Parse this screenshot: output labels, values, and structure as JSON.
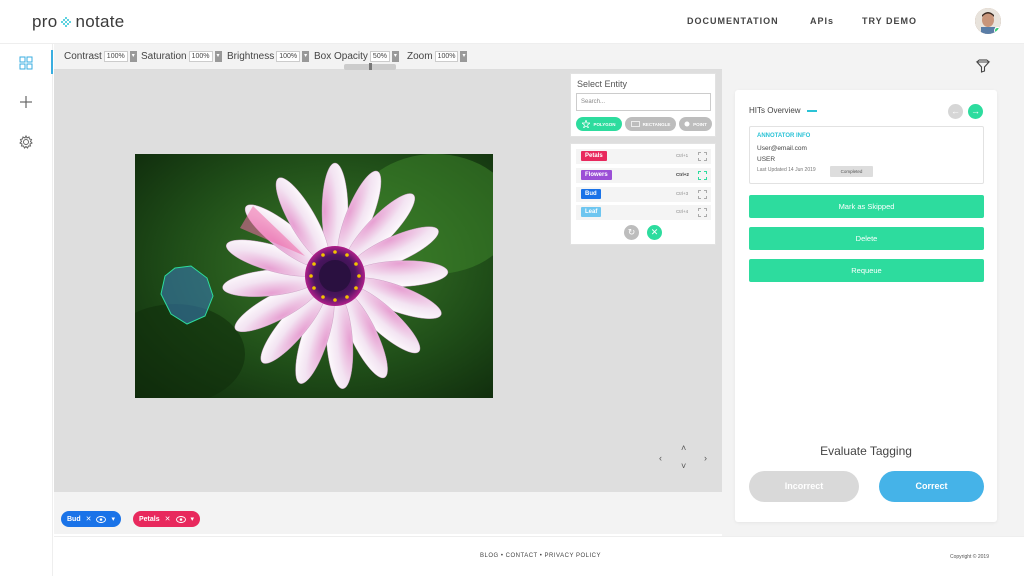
{
  "brand": {
    "logo_left": "pro",
    "logo_right": "notate"
  },
  "nav": {
    "documentation": "DOCUMENTATION",
    "apis": "APIs",
    "try_demo": "TRY DEMO"
  },
  "toolbar": {
    "contrast": {
      "label": "Contrast",
      "value": "100%"
    },
    "saturation": {
      "label": "Saturation",
      "value": "100%"
    },
    "brightness": {
      "label": "Brightness",
      "value": "100%"
    },
    "box_opacity": {
      "label": "Box Opacity",
      "value": "50%"
    },
    "zoom": {
      "label": "Zoom",
      "value": "100%"
    }
  },
  "entity_panel": {
    "title": "Select Entity",
    "search_placeholder": "Search...",
    "shapes": {
      "polygon": "POLYGON",
      "rectangle": "RECTANGLE",
      "point": "POINT"
    }
  },
  "labels": [
    {
      "name": "Petals",
      "shortcut": "Ctrl+1",
      "color": "#e8295d"
    },
    {
      "name": "Flowers",
      "shortcut": "Ctrl+2",
      "color": "#9b4fd6"
    },
    {
      "name": "Bud",
      "shortcut": "Ctrl+3",
      "color": "#1a73e8"
    },
    {
      "name": "Leaf",
      "shortcut": "Ctrl+4",
      "color": "#6ec6f0"
    }
  ],
  "tags": [
    {
      "name": "Bud",
      "color": "#1a73e8"
    },
    {
      "name": "Petals",
      "color": "#e8295d"
    }
  ],
  "right_panel": {
    "hits_title": "HITs Overview",
    "annotator_header": "ANNOTATOR INFO",
    "email": "User@email.com",
    "role": "USER",
    "last_updated": "Last Updated 14 Jun 2019",
    "status": "Completed",
    "actions": {
      "skip": "Mark as Skipped",
      "delete": "Delete",
      "requeue": "Requeue"
    },
    "evaluate_title": "Evaluate Tagging",
    "incorrect": "Incorrect",
    "correct": "Correct"
  },
  "footer": {
    "blog": "BLOG",
    "contact": "CONTACT",
    "privacy": "PRIVACY POLICY",
    "copyright": "Copyright © 2019"
  },
  "colors": {
    "accent_green": "#2ddc9e",
    "accent_blue": "#3aaee0",
    "correct_blue": "#45b3e8",
    "incorrect_grey": "#d9d9d9"
  }
}
